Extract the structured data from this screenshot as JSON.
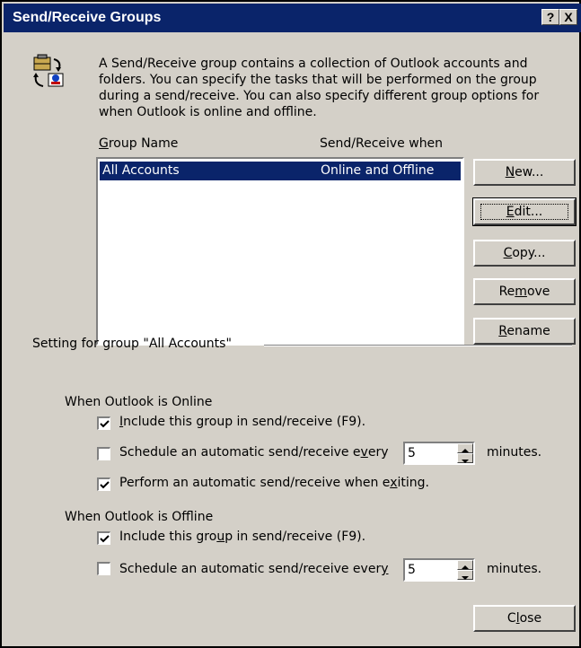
{
  "window": {
    "title": "Send/Receive Groups",
    "help_btn": "?",
    "close_btn": "X"
  },
  "description": "A Send/Receive group contains a collection of Outlook accounts and folders. You can specify the tasks that will be performed on the group during a send/receive. You can also specify different group options for when Outlook is online and offline.",
  "list": {
    "headers": {
      "group_name": "Group Name",
      "when": "Send/Receive when"
    },
    "rows": [
      {
        "name": "All Accounts",
        "when": "Online and Offline",
        "selected": true
      }
    ]
  },
  "buttons": {
    "new": "New...",
    "edit": "Edit...",
    "copy": "Copy...",
    "remove": "Remove",
    "rename": "Rename",
    "close": "Close"
  },
  "settings": {
    "group_label": "Setting for group \"All Accounts\"",
    "online": {
      "heading": "When Outlook is Online",
      "include": {
        "label": "Include this group in send/receive (F9).",
        "checked": true
      },
      "schedule": {
        "label": "Schedule an automatic send/receive every",
        "checked": false,
        "minutes": "5",
        "unit": "minutes."
      },
      "exit": {
        "label": "Perform an automatic send/receive when exiting.",
        "checked": true
      }
    },
    "offline": {
      "heading": "When Outlook is Offline",
      "include": {
        "label": "Include this group in send/receive (F9).",
        "checked": true
      },
      "schedule": {
        "label": "Schedule an automatic send/receive every",
        "checked": false,
        "minutes": "5",
        "unit": "minutes."
      }
    }
  },
  "icons": {
    "header_icon": "send-receive-icon"
  }
}
